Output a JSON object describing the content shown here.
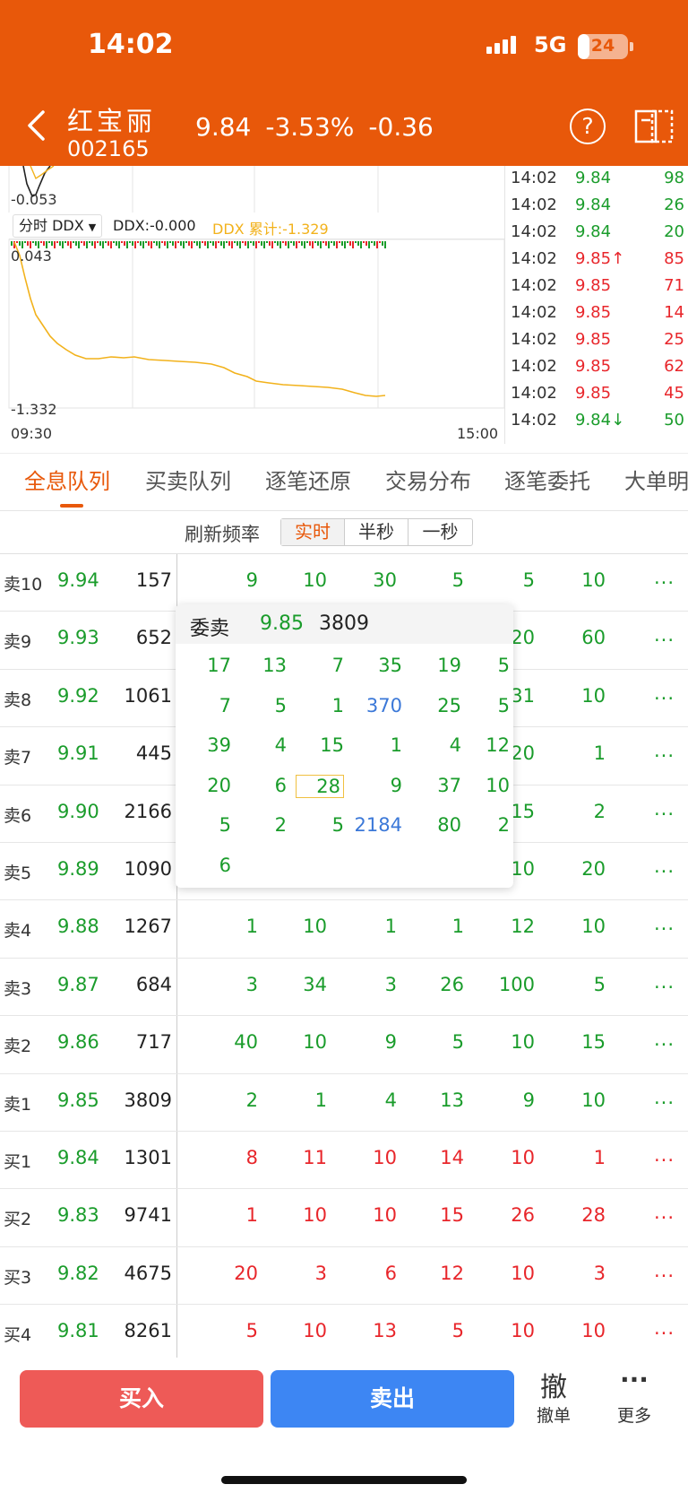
{
  "status_bar": {
    "time": "14:02",
    "network": "5G",
    "battery": "24",
    "battery_level": 0.24
  },
  "header": {
    "stock_name": "红宝丽",
    "stock_code": "002165",
    "price": "9.84",
    "change_pct": "-3.53%",
    "change": "-0.36",
    "help_symbol": "?",
    "icons": [
      "back-icon",
      "help-icon",
      "layout-switch-icon"
    ]
  },
  "chart": {
    "top_value": "-0.053",
    "ddx_selector": "分时 DDX",
    "ddx_value": "DDX:-0.000",
    "ddx_cum": "DDX 累计:-1.329",
    "ddx_max_label": "0.043",
    "ddx_min_label": "-1.332",
    "time_start": "09:30",
    "time_end": "15:00",
    "colors": {
      "cum_line": "#F2B21C",
      "up": "#E8262B",
      "down": "#1a9c2b"
    }
  },
  "ticks": [
    {
      "time": "14:02",
      "price": "9.84",
      "vol": "98",
      "color": "green",
      "arrow": ""
    },
    {
      "time": "14:02",
      "price": "9.84",
      "vol": "26",
      "color": "green",
      "arrow": ""
    },
    {
      "time": "14:02",
      "price": "9.84",
      "vol": "20",
      "color": "green",
      "arrow": ""
    },
    {
      "time": "14:02",
      "price": "9.85",
      "vol": "85",
      "color": "red",
      "arrow": "↑"
    },
    {
      "time": "14:02",
      "price": "9.85",
      "vol": "71",
      "color": "red",
      "arrow": ""
    },
    {
      "time": "14:02",
      "price": "9.85",
      "vol": "14",
      "color": "red",
      "arrow": ""
    },
    {
      "time": "14:02",
      "price": "9.85",
      "vol": "25",
      "color": "red",
      "arrow": ""
    },
    {
      "time": "14:02",
      "price": "9.85",
      "vol": "62",
      "color": "red",
      "arrow": ""
    },
    {
      "time": "14:02",
      "price": "9.85",
      "vol": "45",
      "color": "red",
      "arrow": ""
    },
    {
      "time": "14:02",
      "price": "9.84",
      "vol": "50",
      "color": "green",
      "arrow": "↓"
    }
  ],
  "tabs": [
    {
      "label": "全息队列",
      "active": true
    },
    {
      "label": "买卖队列",
      "active": false
    },
    {
      "label": "逐笔还原",
      "active": false
    },
    {
      "label": "交易分布",
      "active": false
    },
    {
      "label": "逐笔委托",
      "active": false
    },
    {
      "label": "大单明",
      "active": false
    }
  ],
  "refresh": {
    "label": "刷新频率",
    "options": [
      "实时",
      "半秒",
      "一秒"
    ],
    "selected": "实时"
  },
  "order_book": [
    {
      "level": "卖10",
      "price": "9.94",
      "vol": "157",
      "side": "sell",
      "queue": [
        "9",
        "10",
        "30",
        "5",
        "5",
        "10"
      ]
    },
    {
      "level": "卖9",
      "price": "9.93",
      "vol": "652",
      "side": "sell",
      "queue": [
        "",
        "",
        "",
        "",
        "20",
        "60"
      ]
    },
    {
      "level": "卖8",
      "price": "9.92",
      "vol": "1061",
      "side": "sell",
      "queue": [
        "",
        "",
        "",
        "",
        "31",
        "10"
      ]
    },
    {
      "level": "卖7",
      "price": "9.91",
      "vol": "445",
      "side": "sell",
      "queue": [
        "",
        "",
        "",
        "",
        "20",
        "1"
      ]
    },
    {
      "level": "卖6",
      "price": "9.90",
      "vol": "2166",
      "side": "sell",
      "queue": [
        "",
        "",
        "",
        "",
        "15",
        "2"
      ]
    },
    {
      "level": "卖5",
      "price": "9.89",
      "vol": "1090",
      "side": "sell",
      "queue": [
        "",
        "",
        "",
        "",
        "10",
        "20"
      ]
    },
    {
      "level": "卖4",
      "price": "9.88",
      "vol": "1267",
      "side": "sell",
      "queue": [
        "1",
        "10",
        "1",
        "1",
        "12",
        "10"
      ]
    },
    {
      "level": "卖3",
      "price": "9.87",
      "vol": "684",
      "side": "sell",
      "queue": [
        "3",
        "34",
        "3",
        "26",
        "100",
        "5"
      ]
    },
    {
      "level": "卖2",
      "price": "9.86",
      "vol": "717",
      "side": "sell",
      "queue": [
        "40",
        "10",
        "9",
        "5",
        "10",
        "15"
      ]
    },
    {
      "level": "卖1",
      "price": "9.85",
      "vol": "3809",
      "side": "sell",
      "queue": [
        "2",
        "1",
        "4",
        "13",
        "9",
        "10"
      ]
    },
    {
      "level": "买1",
      "price": "9.84",
      "vol": "1301",
      "side": "buy",
      "queue": [
        "8",
        "11",
        "10",
        "14",
        "10",
        "1"
      ]
    },
    {
      "level": "买2",
      "price": "9.83",
      "vol": "9741",
      "side": "buy",
      "queue": [
        "1",
        "10",
        "10",
        "15",
        "26",
        "28"
      ]
    },
    {
      "level": "买3",
      "price": "9.82",
      "vol": "4675",
      "side": "buy",
      "queue": [
        "20",
        "3",
        "6",
        "12",
        "10",
        "3"
      ]
    },
    {
      "level": "买4",
      "price": "9.81",
      "vol": "8261",
      "side": "buy",
      "queue": [
        "5",
        "10",
        "13",
        "5",
        "10",
        "10"
      ]
    }
  ],
  "more_label": "...",
  "popup": {
    "title": "委卖",
    "price": "9.85",
    "vol": "3809",
    "rows": [
      [
        "17",
        "13",
        "7",
        "35",
        "19",
        "5"
      ],
      [
        "7",
        "5",
        "1",
        "370",
        "25",
        "5"
      ],
      [
        "39",
        "4",
        "15",
        "1",
        "4",
        "12"
      ],
      [
        "20",
        "6",
        "28",
        "9",
        "37",
        "10"
      ],
      [
        "5",
        "2",
        "5",
        "2184",
        "80",
        "2"
      ],
      [
        "6",
        "",
        "",
        "",
        "",
        ""
      ]
    ],
    "highlight_values": [
      "370",
      "2184"
    ],
    "selected_value": "28"
  },
  "bottom": {
    "buy_label": "买入",
    "sell_label": "卖出",
    "cancel_glyph": "撤",
    "cancel_label": "撤单",
    "more_glyph": "···",
    "more_label": "更多"
  }
}
